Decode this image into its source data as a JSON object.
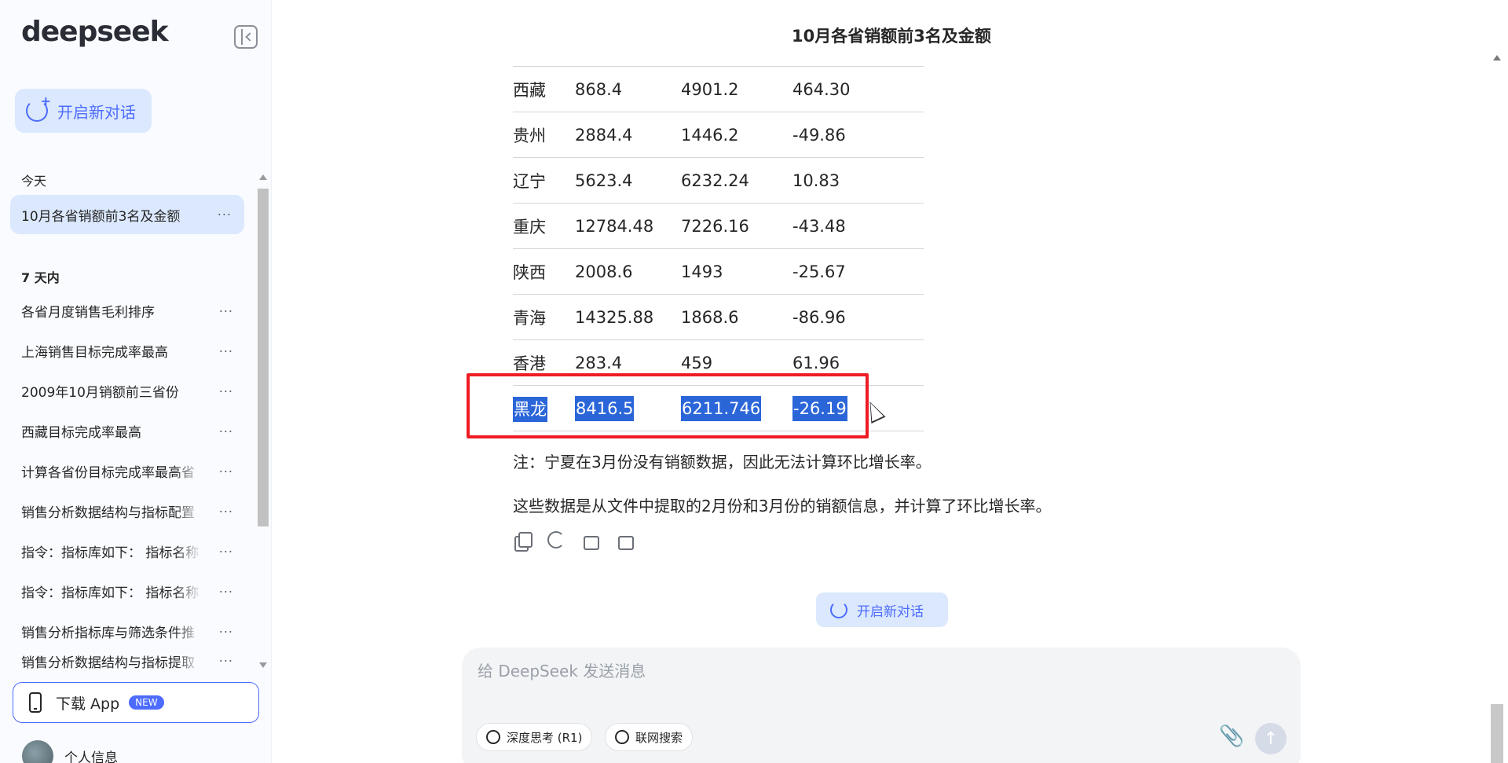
{
  "sidebar": {
    "logo": "deepseek",
    "new_chat_label": "开启新对话",
    "today_label": "今天",
    "week_label": "7 天内",
    "active_item": "10月各省销额前3名及金额",
    "more_glyph": "···",
    "items": [
      "各省月度销售毛利排序",
      "上海销售目标完成率最高",
      "2009年10月销额前三省份",
      "西藏目标完成率最高",
      "计算各省份目标完成率最高省",
      "销售分析数据结构与指标配置",
      "指令：指标库如下：  指标名称",
      "指令：指标库如下：  指标名称",
      "销售分析指标库与筛选条件推",
      "销售分析数据结构与指标提取"
    ],
    "download_label": "下载 App",
    "new_badge": "NEW",
    "profile_label": "个人信息"
  },
  "main": {
    "title": "10月各省销额前3名及金额",
    "table_rows": [
      [
        "西藏",
        "868.4",
        "4901.2",
        "464.30"
      ],
      [
        "贵州",
        "2884.4",
        "1446.2",
        "-49.86"
      ],
      [
        "辽宁",
        "5623.4",
        "6232.24",
        "10.83"
      ],
      [
        "重庆",
        "12784.48",
        "7226.16",
        "-43.48"
      ],
      [
        "陕西",
        "2008.6",
        "1493",
        "-25.67"
      ],
      [
        "青海",
        "14325.88",
        "1868.6",
        "-86.96"
      ],
      [
        "香港",
        "283.4",
        "459",
        "61.96"
      ]
    ],
    "selected_row": [
      "黑龙",
      "8416.5",
      "6211.746",
      "-26.19"
    ],
    "note": "注：宁夏在3月份没有销额数据，因此无法计算环比增长率。",
    "summary": "这些数据是从文件中提取的2月份和3月份的销额信息，并计算了环比增长率。",
    "new_chat_label": "开启新对话",
    "composer": {
      "placeholder": "给 DeepSeek 发送消息",
      "deep_think_label": "深度思考 (R1)",
      "web_search_label": "联网搜索",
      "send_glyph": "↑",
      "attach_glyph": "📎"
    }
  },
  "colors": {
    "accent": "#4d6bfe",
    "selection": "#2b66d9",
    "highlight_box": "#ee1c24",
    "sidebar_bg": "#f9fbff"
  }
}
